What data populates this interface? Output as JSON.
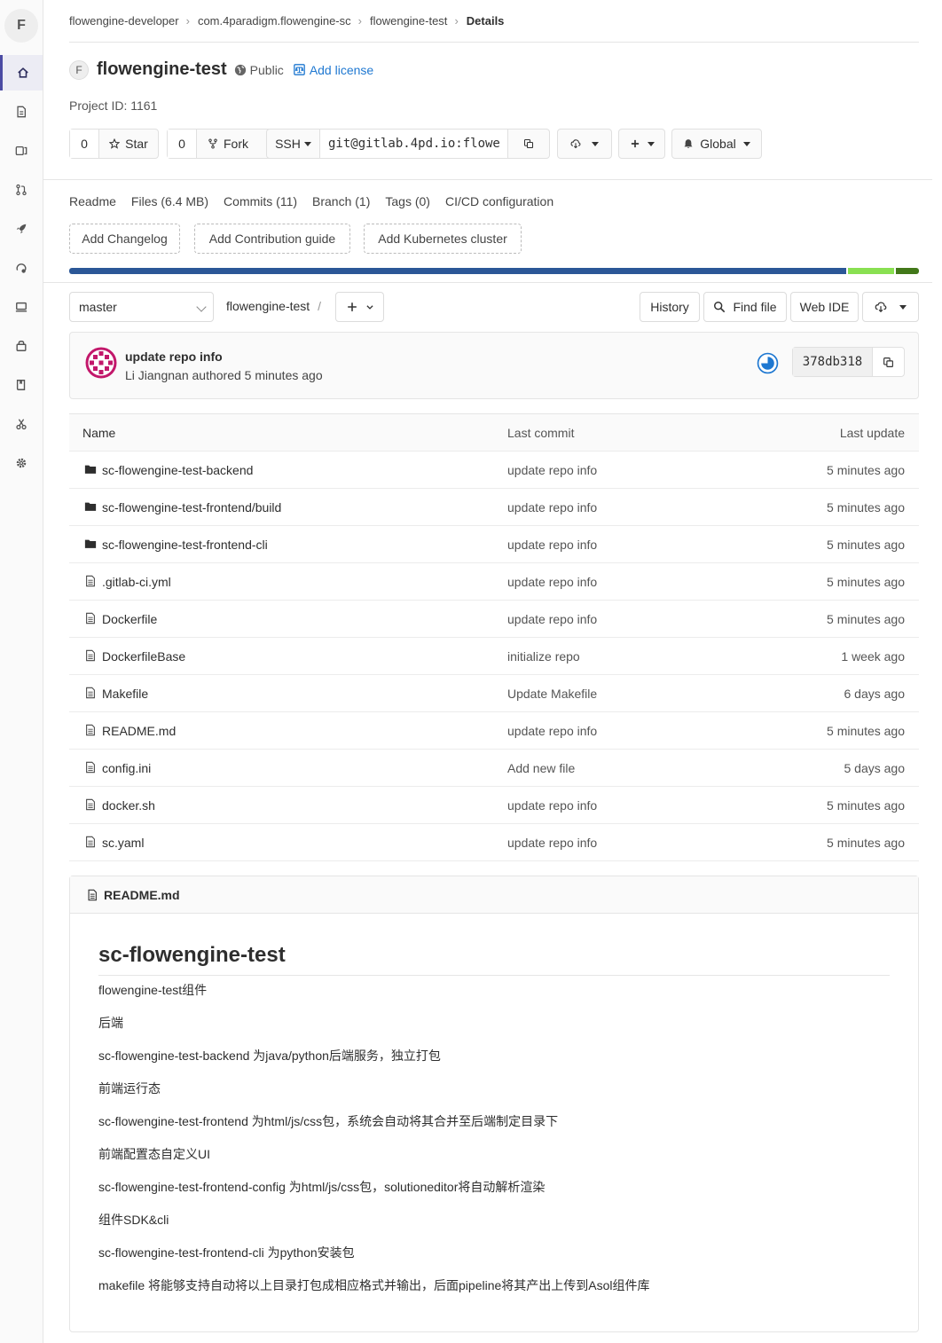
{
  "sidebar": {
    "avatar_letter": "F",
    "items": [
      "home-icon",
      "file-icon",
      "issues-icon",
      "merge-request-icon",
      "rocket-icon",
      "operations-icon",
      "monitor-icon",
      "package-icon",
      "wiki-icon",
      "snippets-icon",
      "settings-icon"
    ]
  },
  "breadcrumb": [
    "flowengine-developer",
    "com.4paradigm.flowengine-sc",
    "flowengine-test",
    "Details"
  ],
  "project": {
    "avatar_letter": "F",
    "name": "flowengine-test",
    "visibility": "Public",
    "add_license": "Add license",
    "id_text": "Project ID: 1161"
  },
  "actions": {
    "star_count": "0",
    "star_label": "Star",
    "fork_count": "0",
    "fork_label": "Fork",
    "clone_protocol": "SSH",
    "clone_url": "git@gitlab.4pd.io:flowe",
    "notification": "Global"
  },
  "nav_links": [
    "Readme",
    "Files (6.4 MB)",
    "Commits (11)",
    "Branch (1)",
    "Tags (0)",
    "CI/CD configuration"
  ],
  "add_buttons": [
    "Add Changelog",
    "Add Contribution guide",
    "Add Kubernetes cluster"
  ],
  "language_bar": [
    {
      "color": "#2b5797",
      "fraction": 0.918
    },
    {
      "color": "#89e051",
      "fraction": 0.055
    },
    {
      "color": "#427819",
      "fraction": 0.027
    }
  ],
  "toolbar": {
    "branch": "master",
    "path": "flowengine-test",
    "slash": "/",
    "history": "History",
    "find_file": "Find file",
    "web_ide": "Web IDE"
  },
  "last_commit": {
    "title": "update repo info",
    "meta": "Li Jiangnan authored 5 minutes ago",
    "sha": "378db318"
  },
  "files": {
    "headers": [
      "Name",
      "Last commit",
      "Last update"
    ],
    "rows": [
      {
        "type": "folder",
        "name": "sc-flowengine-test-backend",
        "commit": "update repo info",
        "updated": "5 minutes ago"
      },
      {
        "type": "folder",
        "name": "sc-flowengine-test-frontend/build",
        "commit": "update repo info",
        "updated": "5 minutes ago"
      },
      {
        "type": "folder",
        "name": "sc-flowengine-test-frontend-cli",
        "commit": "update repo info",
        "updated": "5 minutes ago"
      },
      {
        "type": "file",
        "name": ".gitlab-ci.yml",
        "commit": "update repo info",
        "updated": "5 minutes ago"
      },
      {
        "type": "file",
        "name": "Dockerfile",
        "commit": "update repo info",
        "updated": "5 minutes ago"
      },
      {
        "type": "file",
        "name": "DockerfileBase",
        "commit": "initialize repo",
        "updated": "1 week ago"
      },
      {
        "type": "file",
        "name": "Makefile",
        "commit": "Update Makefile",
        "updated": "6 days ago"
      },
      {
        "type": "file",
        "name": "README.md",
        "commit": "update repo info",
        "updated": "5 minutes ago"
      },
      {
        "type": "file",
        "name": "config.ini",
        "commit": "Add new file",
        "updated": "5 days ago"
      },
      {
        "type": "file",
        "name": "docker.sh",
        "commit": "update repo info",
        "updated": "5 minutes ago"
      },
      {
        "type": "file",
        "name": "sc.yaml",
        "commit": "update repo info",
        "updated": "5 minutes ago"
      }
    ]
  },
  "readme": {
    "filename": "README.md",
    "heading": "sc-flowengine-test",
    "paragraphs": [
      "flowengine-test组件",
      "后端",
      "sc-flowengine-test-backend 为java/python后端服务，独立打包",
      "前端运行态",
      "sc-flowengine-test-frontend 为html/js/css包，系统会自动将其合并至后端制定目录下",
      "前端配置态自定义UI",
      "sc-flowengine-test-frontend-config 为html/js/css包，solutioneditor将自动解析渲染",
      "组件SDK&cli",
      "sc-flowengine-test-frontend-cli 为python安装包",
      "makefile 将能够支持自动将以上目录打包成相应格式并输出，后面pipeline将其产出上传到Asol组件库"
    ]
  }
}
